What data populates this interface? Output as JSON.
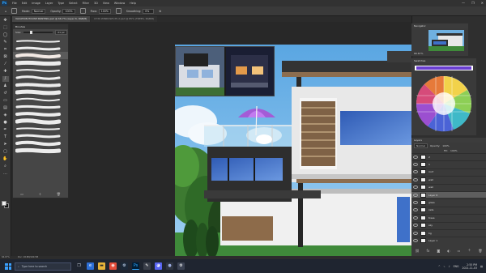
{
  "menubar": {
    "app_logo": "Ps",
    "items": [
      "File",
      "Edit",
      "Image",
      "Layer",
      "Type",
      "Select",
      "Filter",
      "3D",
      "View",
      "Window",
      "Help"
    ],
    "window_controls": [
      "—",
      "❐",
      "✕"
    ]
  },
  "options": {
    "mode_label": "Mode:",
    "mode_value": "Normal",
    "opacity_label": "Opacity:",
    "opacity_value": "100%",
    "flow_label": "Flow:",
    "flow_value": "100%",
    "smoothing_label": "Smoothing:",
    "smoothing_value": "0%"
  },
  "tabs": [
    "VACATION HOUSE PAINTING.psd @ 66.7% (Layer 6, RGB/8)",
    "0730 WINDOWS PS 2.psd @ 85% (TREES, RGB/8)"
  ],
  "brushes_panel": {
    "title": "Brushes",
    "size_label": "Size:",
    "size_value": "21 px",
    "stroke_count": 16
  },
  "navigator": {
    "title": "Navigator",
    "zoom": "66.67%"
  },
  "swatches": {
    "title": "Swatches"
  },
  "layers": {
    "title": "Layers",
    "blend_mode": "Normal",
    "opacity_label": "Opacity:",
    "opacity_value": "100%",
    "fill_label": "Fill:",
    "fill_value": "100%",
    "rows": [
      "2",
      "1",
      "roof",
      "wall",
      "wall",
      "Layer 6",
      "glass",
      "rails",
      "trees",
      "sky",
      "bg",
      "Layer 1"
    ],
    "selected_index": 5
  },
  "status": {
    "zoom": "66.67%",
    "doc": "Doc: 18.8M/190.5M"
  },
  "taskbar": {
    "search_placeholder": "Type here to search",
    "lang": "ENG",
    "time": "2:55 PM",
    "date": "2021-11-03"
  },
  "colors": {
    "sky": "#6db6e8",
    "wall_white": "#e8e8e8",
    "glass_blue": "#3f71c9",
    "roof_dark": "#323232",
    "wood": "#8d6b4a",
    "umbrella": "#a45cd6"
  }
}
